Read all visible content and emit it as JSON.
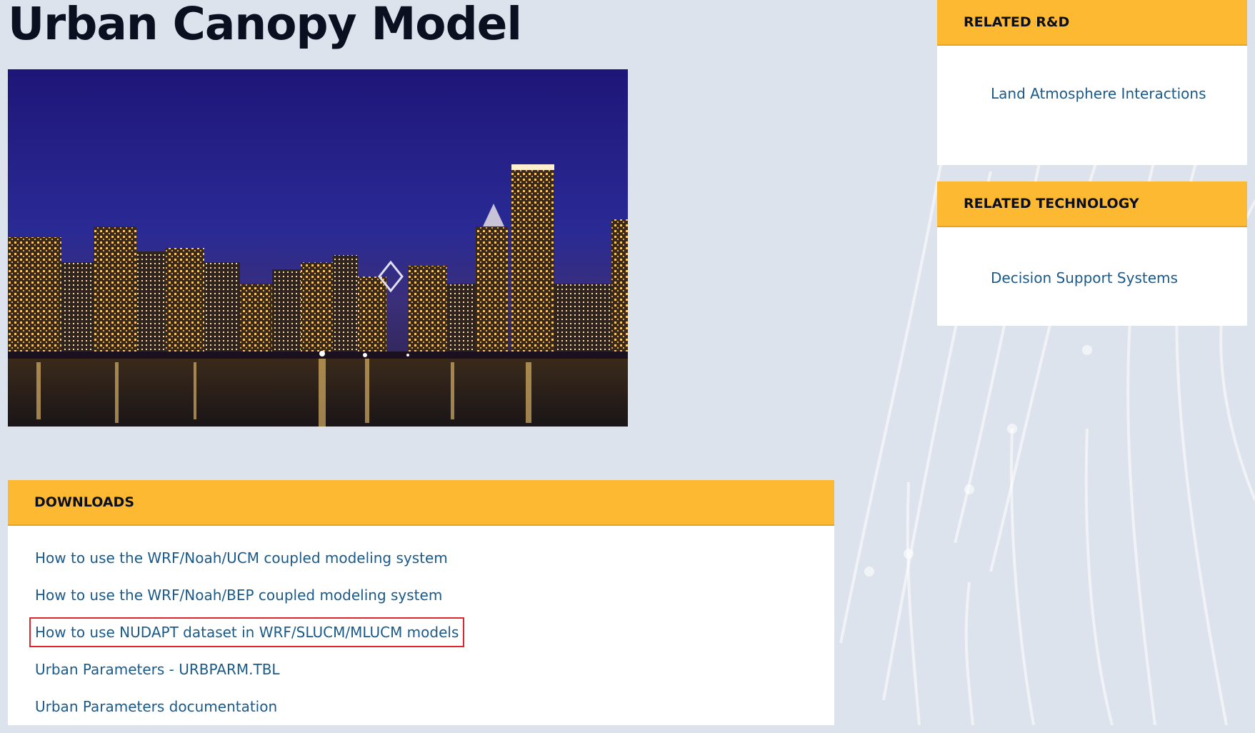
{
  "page": {
    "title": "Urban Canopy Model"
  },
  "hero_image": {
    "subject": "city skyline at night over water"
  },
  "downloads": {
    "header": "DOWNLOADS",
    "items": [
      {
        "label": "How to use the WRF/Noah/UCM coupled modeling system",
        "highlighted": false
      },
      {
        "label": "How to use the WRF/Noah/BEP coupled modeling system",
        "highlighted": false
      },
      {
        "label": "How to use NUDAPT dataset in WRF/SLUCM/MLUCM models",
        "highlighted": true
      },
      {
        "label": "Urban Parameters - URBPARM.TBL",
        "highlighted": false
      },
      {
        "label": "Urban Parameters documentation",
        "highlighted": false
      }
    ]
  },
  "related_rd": {
    "header": "RELATED R&D",
    "links": [
      "Land Atmosphere Interactions"
    ]
  },
  "related_technology": {
    "header": "RELATED TECHNOLOGY",
    "links": [
      "Decision Support Systems"
    ]
  },
  "colors": {
    "page_bg": "#dde3ec",
    "header_bg": "#fdb932",
    "link": "#1a5a8a",
    "highlight_border": "#e0262d",
    "title": "#0b1020"
  }
}
